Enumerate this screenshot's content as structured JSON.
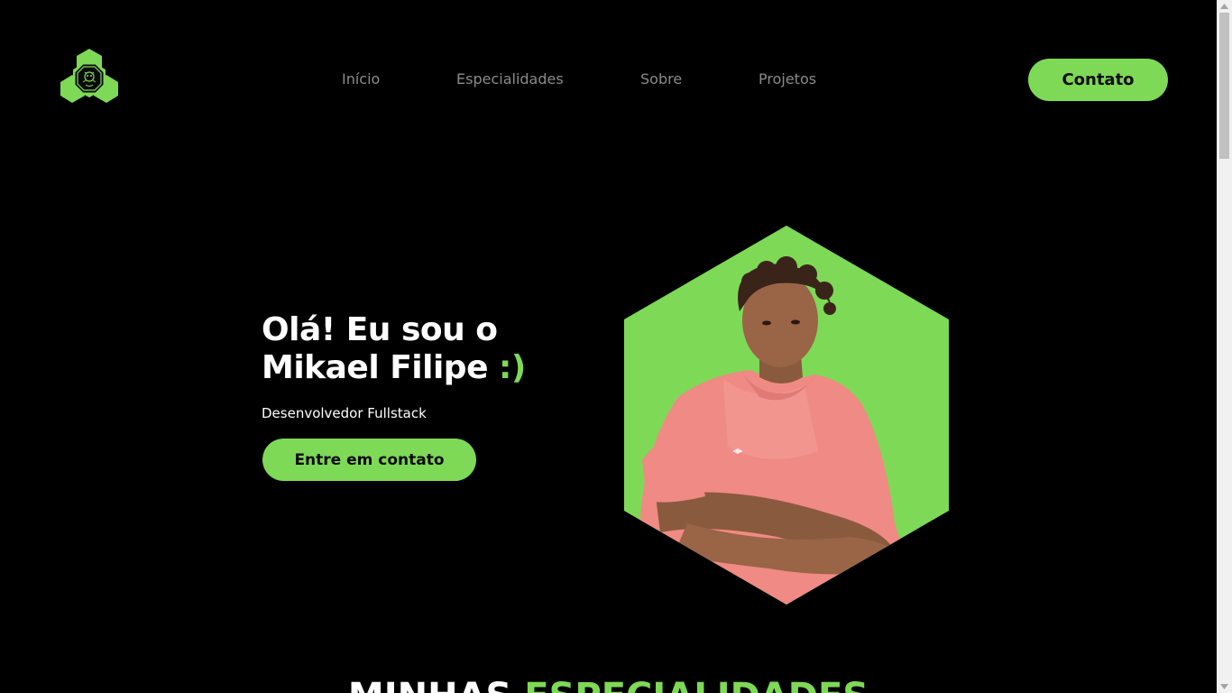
{
  "header": {
    "logo_icon": "hexagon-logo-icon",
    "nav": [
      "Início",
      "Especialidades",
      "Sobre",
      "Projetos"
    ],
    "contact_label": "Contato"
  },
  "hero": {
    "title_line1": "Olá! Eu sou o",
    "title_line2": "Mikael Filipe ",
    "title_smile": ":)",
    "subtitle": "Desenvolvedor Fullstack",
    "cta_label": "Entre em contato",
    "portrait_icon": "profile-photo"
  },
  "section": {
    "title_white": "MINHAS ",
    "title_green": "ESPECIALIDADES"
  },
  "colors": {
    "background": "#000000",
    "accent": "#7ed957",
    "nav_text": "#8a8a8a",
    "text": "#ffffff"
  }
}
